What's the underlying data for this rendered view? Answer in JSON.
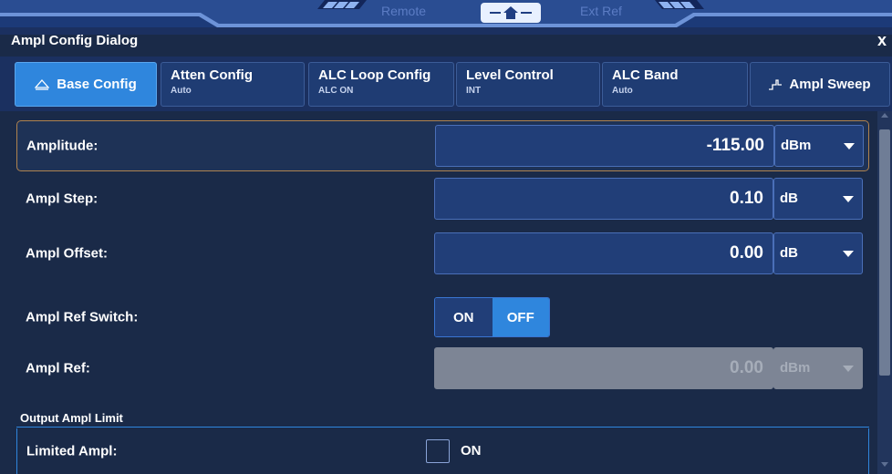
{
  "status_bar": {
    "remote": "Remote",
    "ext_ref": "Ext Ref"
  },
  "dialog": {
    "title": "Ampl Config Dialog",
    "close": "x"
  },
  "tabs": [
    {
      "label": "Base Config",
      "sub": "",
      "icon": "triangle-up-icon",
      "active": true
    },
    {
      "label": "Atten Config",
      "sub": "Auto",
      "active": false
    },
    {
      "label": "ALC Loop Config",
      "sub": "ALC ON",
      "active": false
    },
    {
      "label": "Level Control",
      "sub": "INT",
      "active": false
    },
    {
      "label": "ALC Band",
      "sub": "Auto",
      "active": false
    },
    {
      "label": "Ampl Sweep",
      "sub": "",
      "icon": "sweep-icon",
      "active": false
    }
  ],
  "fields": {
    "amplitude": {
      "label": "Amplitude:",
      "value": "-115.00",
      "unit": "dBm"
    },
    "ampl_step": {
      "label": "Ampl Step:",
      "value": "0.10",
      "unit": "dB"
    },
    "ampl_offset": {
      "label": "Ampl Offset:",
      "value": "0.00",
      "unit": "dB"
    },
    "ampl_ref_switch": {
      "label": "Ampl Ref Switch:",
      "on": "ON",
      "off": "OFF",
      "selected": "OFF"
    },
    "ampl_ref": {
      "label": "Ampl Ref:",
      "value": "0.00",
      "unit": "dBm",
      "disabled": true
    }
  },
  "section": {
    "title": "Output Ampl Limit"
  },
  "limited_ampl": {
    "label": "Limited Ampl:",
    "checkbox_label": "ON",
    "checked": false
  },
  "colors": {
    "accent": "#2f86dd",
    "background": "#1a2a48",
    "field": "#213e78",
    "focus_border": "#b0834e",
    "disabled": "#7d8595"
  }
}
